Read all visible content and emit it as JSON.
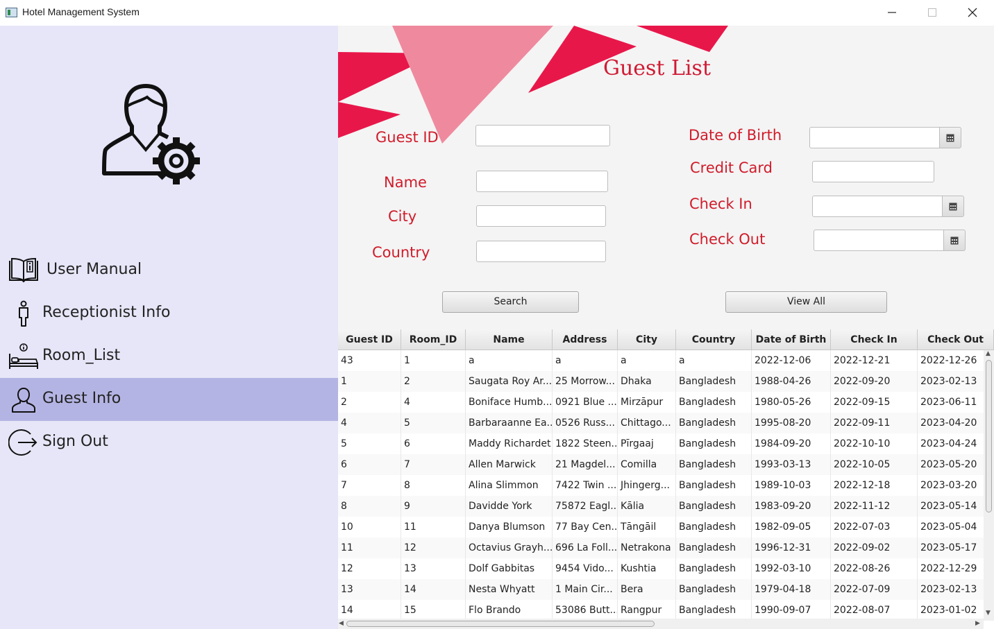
{
  "window": {
    "title": "Hotel Management System"
  },
  "sidebar": {
    "items": [
      {
        "label": "User Manual",
        "icon": "book-info-icon"
      },
      {
        "label": "Receptionist Info",
        "icon": "person-icon"
      },
      {
        "label": "Room_List",
        "icon": "bed-icon"
      },
      {
        "label": "Guest Info",
        "icon": "user-icon",
        "active": true
      },
      {
        "label": "Sign Out",
        "icon": "sign-out-icon"
      }
    ]
  },
  "main": {
    "title": "Guest List",
    "fields": {
      "guest_id": {
        "label": "Guest ID",
        "value": ""
      },
      "name": {
        "label": "Name",
        "value": ""
      },
      "city": {
        "label": "City",
        "value": ""
      },
      "country": {
        "label": "Country",
        "value": ""
      },
      "dob": {
        "label": "Date of Birth",
        "value": ""
      },
      "credit_card": {
        "label": "Credit Card",
        "value": ""
      },
      "check_in": {
        "label": "Check In",
        "value": ""
      },
      "check_out": {
        "label": "Check Out",
        "value": ""
      }
    },
    "search_label": "Search",
    "view_all_label": "View All"
  },
  "table": {
    "columns": [
      "Guest ID",
      "Room_ID",
      "Name",
      "Address",
      "City",
      "Country",
      "Date of Birth",
      "Check In",
      "Check Out"
    ],
    "rows": [
      [
        "43",
        "1",
        "a",
        "a",
        "a",
        "a",
        "2022-12-06",
        "2022-12-21",
        "2022-12-26"
      ],
      [
        "1",
        "2",
        "Saugata Roy Ar...",
        "25 Morrow...",
        "Dhaka",
        "Bangladesh",
        "1988-04-26",
        "2022-09-20",
        "2023-02-13"
      ],
      [
        "2",
        "4",
        "Boniface Humb...",
        "0921 Blue ...",
        "Mirzāpur",
        "Bangladesh",
        "1980-05-26",
        "2022-09-15",
        "2023-06-11"
      ],
      [
        "4",
        "5",
        "Barbaraanne Ea...",
        "0526 Russ...",
        "Chittago...",
        "Bangladesh",
        "1995-08-20",
        "2022-09-11",
        "2023-04-20"
      ],
      [
        "5",
        "6",
        "Maddy Richardet",
        "1822 Steen...",
        "Pīrgaaj",
        "Bangladesh",
        "1984-09-20",
        "2022-10-10",
        "2023-04-24"
      ],
      [
        "6",
        "7",
        "Allen Marwick",
        "21 Magdel...",
        "Comilla",
        "Bangladesh",
        "1993-03-13",
        "2022-10-05",
        "2023-05-20"
      ],
      [
        "7",
        "8",
        "Alina Slimmon",
        "7422 Twin ...",
        "Jhingerg...",
        "Bangladesh",
        "1989-10-03",
        "2022-12-18",
        "2023-03-20"
      ],
      [
        "8",
        "9",
        "Davidde York",
        "75872 Eagl...",
        "Kālia",
        "Bangladesh",
        "1983-09-20",
        "2022-11-12",
        "2023-05-14"
      ],
      [
        "10",
        "11",
        "Danya Blumson",
        "77 Bay Cen...",
        "Tāngāil",
        "Bangladesh",
        "1982-09-05",
        "2022-07-03",
        "2023-05-04"
      ],
      [
        "11",
        "12",
        "Octavius Grayh...",
        "696 La Foll...",
        "Netrakona",
        "Bangladesh",
        "1996-12-31",
        "2022-09-02",
        "2023-05-17"
      ],
      [
        "12",
        "13",
        "Dolf Gabbitas",
        "9454 Vido...",
        "Kushtia",
        "Bangladesh",
        "1992-03-10",
        "2022-08-26",
        "2022-12-29"
      ],
      [
        "13",
        "14",
        "Nesta Whyatt",
        "1 Main Cir...",
        "Bera",
        "Bangladesh",
        "1979-04-18",
        "2022-07-09",
        "2023-02-13"
      ],
      [
        "14",
        "15",
        "Flo Brando",
        "53086 Butt...",
        "Rangpur",
        "Bangladesh",
        "1990-09-07",
        "2022-08-07",
        "2023-01-02"
      ]
    ]
  },
  "colors": {
    "accent": "#d01b2a",
    "sidebar_bg": "#e6e6f8",
    "sidebar_active": "#b4b4e4",
    "decor_pink": "#e8174a",
    "decor_light": "#ef8a9e"
  }
}
